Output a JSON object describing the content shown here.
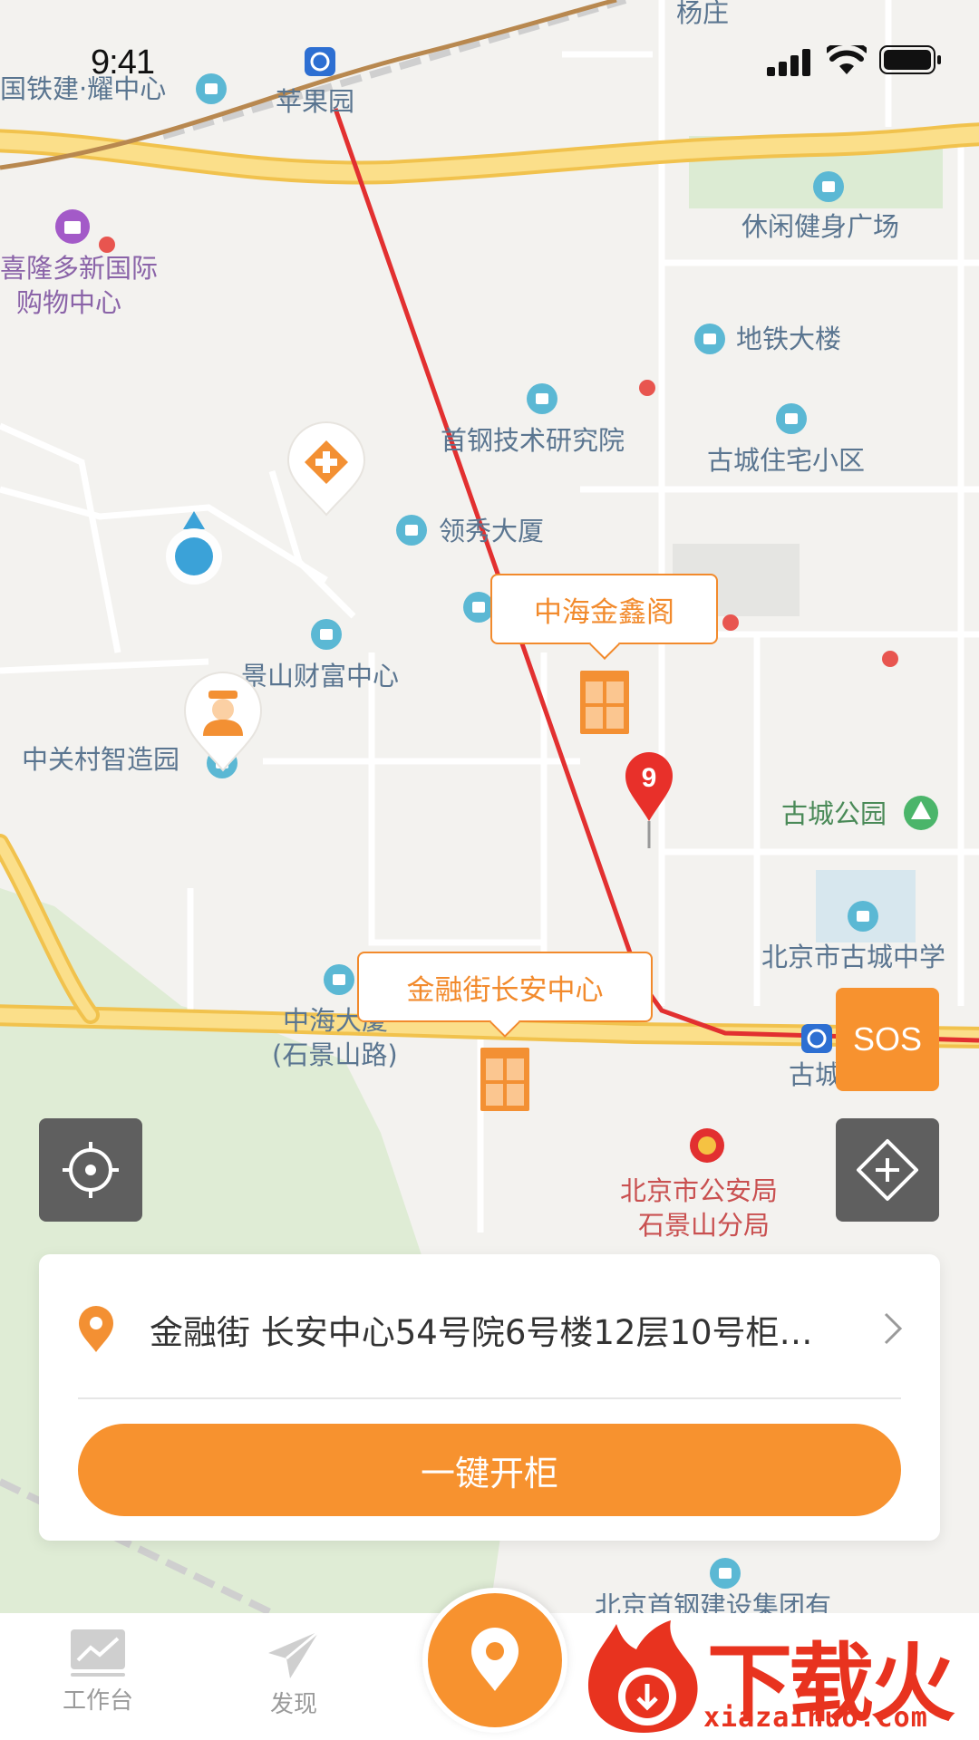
{
  "status_bar": {
    "time": "9:41"
  },
  "map": {
    "labels": {
      "yangzhuang": "杨庄",
      "tiejian": "国铁建·耀中心",
      "pingguoyuan": "苹果园",
      "xilong_1": "喜隆多新国际",
      "xilong_2": "购物中心",
      "xiuxian": "休闲健身广场",
      "ditie_dalou": "地铁大楼",
      "shougang": "首钢技术研究院",
      "gucheng_xiaoqu": "古城住宅小区",
      "lingxiu": "领秀大厦",
      "jingshan": "景山财富中心",
      "zhiguancun": "中关村智造园",
      "gucheng_park": "古城公园",
      "gucheng_school": "北京市古城中学",
      "zhonghai_1": "中海大厦",
      "zhonghai_2": "(石景山路)",
      "gucheng_stn": "古城",
      "police_1": "北京市公安局",
      "police_2": "石景山分局",
      "shougang_group": "北京首钢建设集团有"
    },
    "callouts": {
      "top": "中海金鑫阁",
      "bottom": "金融街长安中心"
    },
    "red_pin_number": "9"
  },
  "sos_label": "SOS",
  "card": {
    "address": "金融街  长安中心54号院6号楼12层10号柜…",
    "open_button": "一键开柜"
  },
  "tabs": [
    {
      "label": "工作台"
    },
    {
      "label": "发现"
    }
  ],
  "watermark": {
    "title": "下载火",
    "url": "xiazaihuo.com"
  },
  "colors": {
    "accent": "#f7922f",
    "dark_button": "#5f5f5f",
    "metro_line": "#e23030",
    "road_yellow": "#f8d26a"
  }
}
